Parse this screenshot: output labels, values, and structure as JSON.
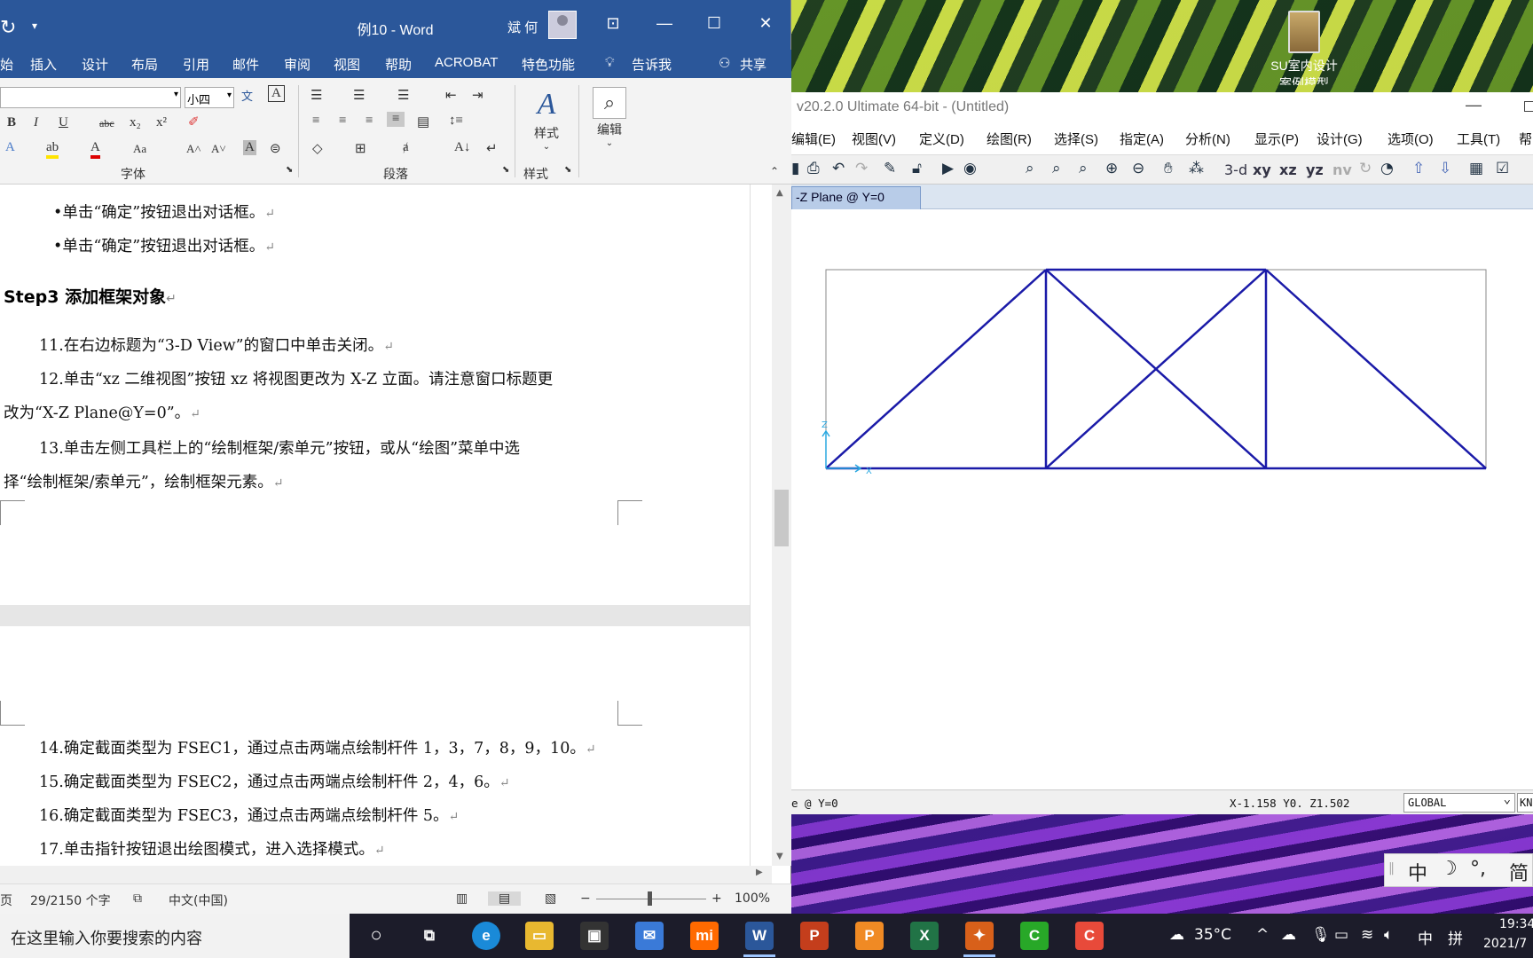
{
  "desktop": {
    "icon_label_1": "SU室内设计",
    "icon_label_2": "案例模型"
  },
  "word": {
    "title": "例10 - Word",
    "user": "斌 何",
    "tabs": [
      "始",
      "插入",
      "设计",
      "布局",
      "引用",
      "邮件",
      "审阅",
      "视图",
      "帮助",
      "ACROBAT",
      "特色功能",
      "告诉我",
      "共享"
    ],
    "ribbon": {
      "font_size": "小四",
      "font_group": "字体",
      "para_group": "段落",
      "style_group": "样式",
      "style_label": "样式",
      "edit_label": "编辑"
    },
    "doc": {
      "bullet1": "•单击“确定”按钮退出对话框。",
      "bullet2": "•单击“确定”按钮退出对话框。",
      "heading": "Step3  添加框架对象",
      "p11": "11.在右边标题为“3-D View”的窗口中单击关闭。",
      "p12a": "12.单击“xz 二维视图”按钮 xz 将视图更改为 X-Z 立面。请注意窗口标题更",
      "p12b": "改为“X-Z Plane@Y=0”。",
      "p13a": "13.单击左侧工具栏上的“绘制框架/索单元”按钮，或从“绘图”菜单中选",
      "p13b": "择“绘制框架/索单元”，绘制框架元素。",
      "p14": "14.确定截面类型为 FSEC1，通过点击两端点绘制杆件 1，3，7，8，9，10。",
      "p15": "15.确定截面类型为 FSEC2，通过点击两端点绘制杆件 2，4，6。",
      "p16": "16.确定截面类型为 FSEC3，通过点击两端点绘制杆件 5。",
      "p17": "17.单击指针按钮退出绘图模式，进入选择模式。"
    },
    "status": {
      "page": "页",
      "words": "29/2150 个字",
      "lang": "中文(中国)",
      "zoom": "100%"
    }
  },
  "sap": {
    "title": "v20.2.0 Ultimate 64-bit - (Untitled)",
    "menu": [
      "编辑(E)",
      "视图(V)",
      "定义(D)",
      "绘图(R)",
      "选择(S)",
      "指定(A)",
      "分析(N)",
      "显示(P)",
      "设计(G)",
      "选项(O)",
      "工具(T)",
      "帮"
    ],
    "toolbar_text": [
      "3-d",
      "xy",
      "xz",
      "yz",
      "nv"
    ],
    "tab": "-Z Plane @ Y=0",
    "status_view": "e @ Y=0",
    "coords": "X-1.158  Y0.  Z1.502",
    "coord_sys": "GLOBAL",
    "units": "KN",
    "axis_z": "Z",
    "axis_x": "X"
  },
  "ime": {
    "mode": "中",
    "moon": "☽",
    "punct": "°,",
    "simp": "简"
  },
  "taskbar": {
    "search_placeholder": "在这里输入你要搜索的内容",
    "temp": "35°C",
    "ime_lang": "中",
    "ime_pinyin": "拼",
    "time": "19:34",
    "date": "2021/7"
  },
  "colors": {
    "word_blue": "#2b579a",
    "frame_blue": "#1a1aa8",
    "axis_cyan": "#2aa8e0"
  }
}
